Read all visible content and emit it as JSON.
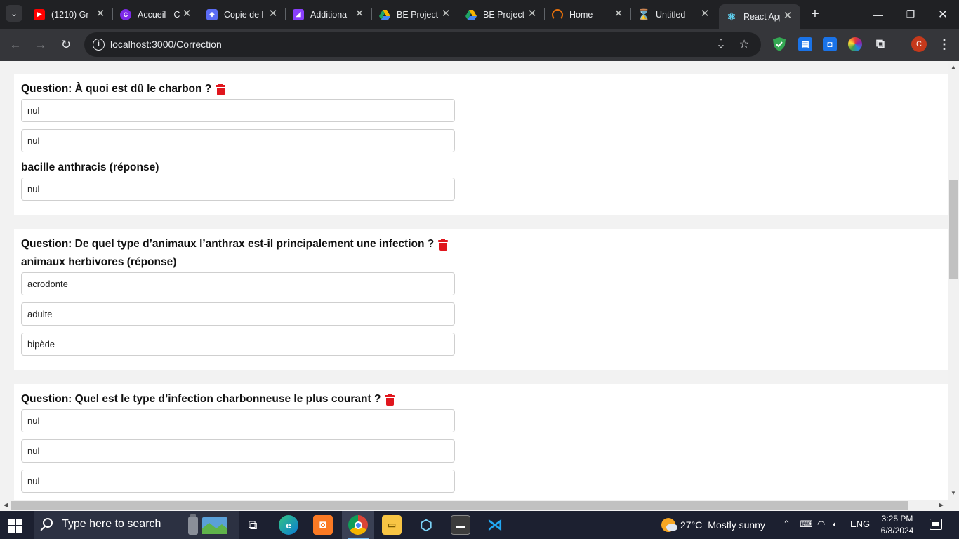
{
  "browser": {
    "tabs": [
      {
        "title": "(1210) Gr",
        "favicon": "youtube-icon",
        "color": "#ff0000"
      },
      {
        "title": "Accueil - C",
        "favicon": "canva-icon",
        "color": "#7d2ae8"
      },
      {
        "title": "Copie de l",
        "favicon": "canva-doc-icon",
        "color": "#5b6cf5"
      },
      {
        "title": "Additiona",
        "favicon": "canva-app-icon",
        "color": "#8a3ffc"
      },
      {
        "title": "BE Project",
        "favicon": "google-drive-icon",
        "color": "#1fa463"
      },
      {
        "title": "BE Project",
        "favicon": "google-drive-icon",
        "color": "#1fa463"
      },
      {
        "title": "Home",
        "favicon": "loading-ring-icon",
        "color": "#e8710a"
      },
      {
        "title": "Untitled",
        "favicon": "hourglass-icon",
        "color": "#f29900"
      },
      {
        "title": "React App",
        "favicon": "react-icon",
        "color": "#61dafb"
      }
    ],
    "url": "localhost:3000/Correction",
    "profile_initial": "C"
  },
  "questions": [
    {
      "title": "Question: À quoi est dû le charbon ?",
      "answer": "bacille anthracis (réponse)",
      "fields": [
        "nul",
        "nul",
        "nul"
      ]
    },
    {
      "title": "Question: De quel type d’animaux l’anthrax est-il principalement une infection ?",
      "answer": "animaux herbivores (réponse)",
      "fields": [
        "acrodonte",
        "adulte",
        "bipède"
      ]
    },
    {
      "title": "Question: Quel est le type d’infection charbonneuse le plus courant ?",
      "fields": [
        "nul",
        "nul",
        "nul"
      ]
    }
  ],
  "taskbar": {
    "search_placeholder": "Type here to search",
    "weather_temp": "27°C",
    "weather_text": "Mostly sunny",
    "language": "ENG",
    "time": "3:25 PM",
    "date": "6/8/2024"
  },
  "colors": {
    "delete_icon": "#e0161d",
    "tab_strip": "#202124",
    "toolbar": "#35363a"
  }
}
